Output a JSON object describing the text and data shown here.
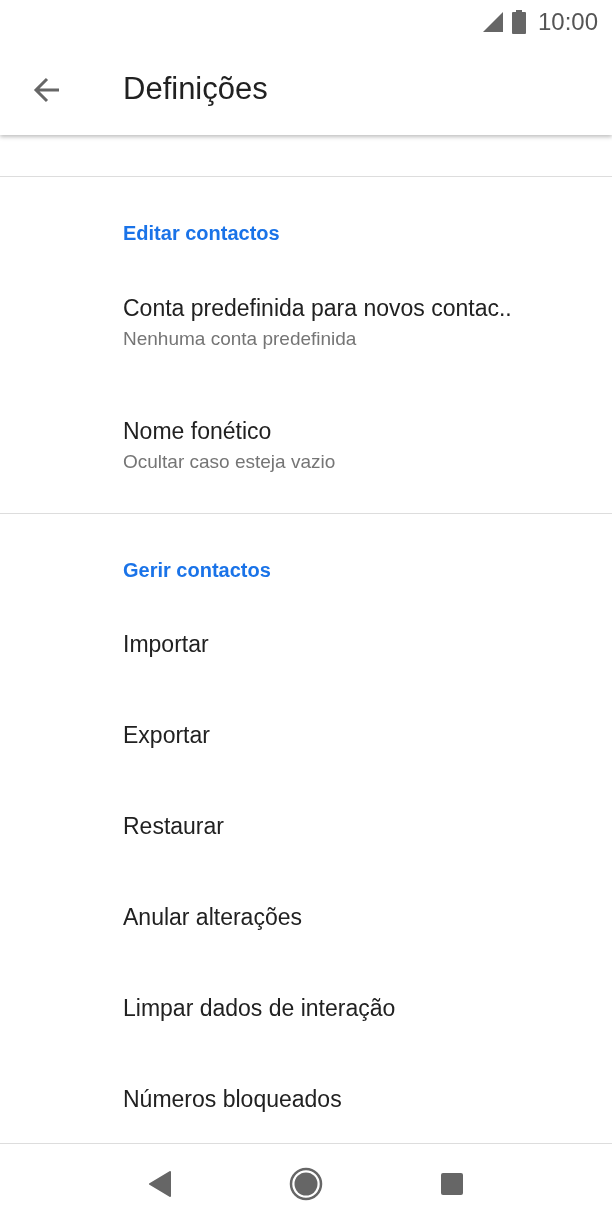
{
  "status_bar": {
    "time": "10:00"
  },
  "app_bar": {
    "title": "Definições"
  },
  "sections": [
    {
      "header": "Editar contactos",
      "items": [
        {
          "title": "Conta predefinida para novos contac..",
          "subtitle": "Nenhuma conta predefinida"
        },
        {
          "title": "Nome fonético",
          "subtitle": "Ocultar caso esteja vazio"
        }
      ]
    },
    {
      "header": "Gerir contactos",
      "items": [
        {
          "title": "Importar"
        },
        {
          "title": "Exportar"
        },
        {
          "title": "Restaurar"
        },
        {
          "title": "Anular alterações"
        },
        {
          "title": "Limpar dados de interação"
        },
        {
          "title": "Números bloqueados"
        }
      ]
    }
  ]
}
